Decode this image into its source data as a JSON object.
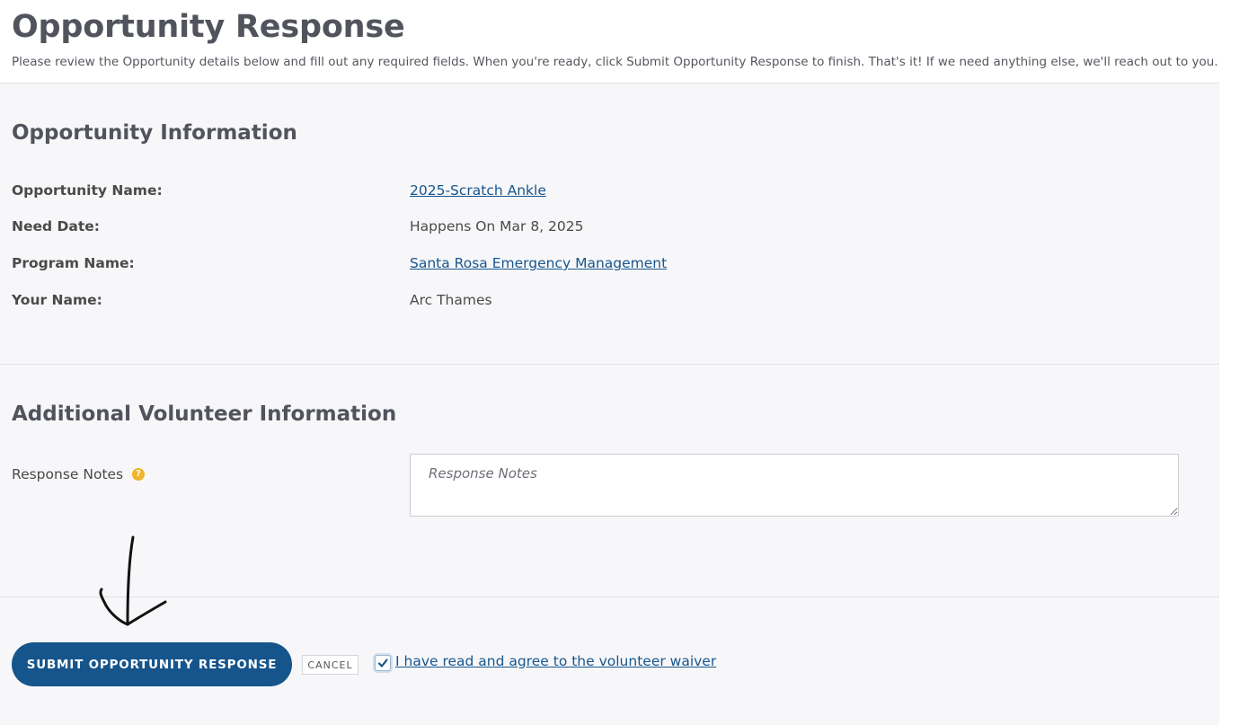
{
  "header": {
    "title": "Opportunity Response",
    "subtitle": "Please review the Opportunity details below and fill out any required fields. When you're ready, click Submit Opportunity Response to finish. That's it! If we need anything else, we'll reach out to you."
  },
  "opportunity_info": {
    "title": "Opportunity Information",
    "rows": [
      {
        "label": "Opportunity Name:",
        "value": "2025-Scratch Ankle",
        "is_link": true
      },
      {
        "label": "Need Date:",
        "value": "Happens On Mar 8, 2025",
        "is_link": false
      },
      {
        "label": "Program Name:",
        "value": "Santa Rosa Emergency Management",
        "is_link": true
      },
      {
        "label": "Your Name:",
        "value": "Arc Thames",
        "is_link": false
      }
    ]
  },
  "additional_info": {
    "title": "Additional Volunteer Information",
    "notes_label": "Response Notes",
    "help_icon_glyph": "?",
    "notes_placeholder": "Response Notes",
    "notes_value": ""
  },
  "actions": {
    "submit_label": "SUBMIT OPPORTUNITY RESPONSE",
    "cancel_label": "CANCEL",
    "waiver_checked": true,
    "waiver_label": "I have read and agree to the volunteer waiver"
  },
  "colors": {
    "primary": "#16558b",
    "link": "#17568e",
    "help": "#f0b429",
    "background": "#f7f7f9"
  },
  "icons": {
    "help": "question-circle-icon",
    "check": "checkmark-icon",
    "annotation": "hand-drawn-down-arrow"
  }
}
